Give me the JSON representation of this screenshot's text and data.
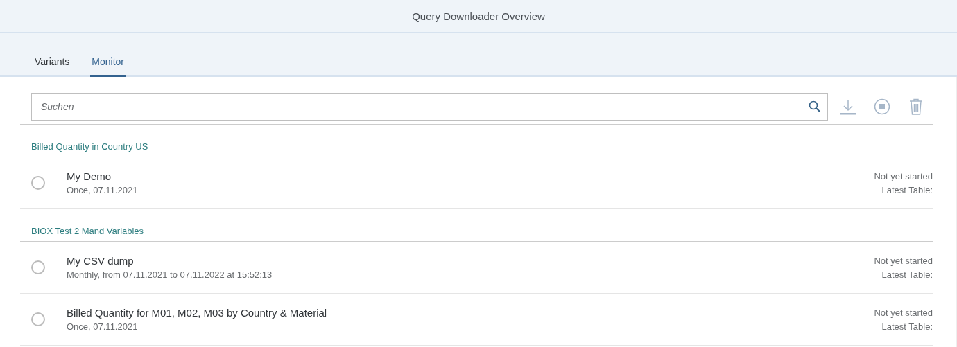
{
  "window": {
    "title": "Query Downloader Overview"
  },
  "tabs": [
    {
      "label": "Variants",
      "selected": false
    },
    {
      "label": "Monitor",
      "selected": true
    }
  ],
  "search": {
    "placeholder": "Suchen"
  },
  "groups": [
    {
      "title": "Billed Quantity in Country US",
      "items": [
        {
          "name": "My Demo",
          "schedule": "Once, 07.11.2021",
          "status": "Not yet started",
          "table": "Latest Table:",
          "selected": false
        }
      ]
    },
    {
      "title": "BIOX Test 2 Mand Variables",
      "items": [
        {
          "name": "My CSV dump",
          "schedule": "Monthly, from 07.11.2021 to 07.11.2022 at 15:52:13",
          "status": "Not yet started",
          "table": "Latest Table:",
          "selected": false
        },
        {
          "name": "Billed Quantity for M01, M02, M03 by Country & Material",
          "schedule": "Once, 07.11.2021",
          "status": "Not yet started",
          "table": "Latest Table:",
          "selected": false
        }
      ]
    }
  ]
}
